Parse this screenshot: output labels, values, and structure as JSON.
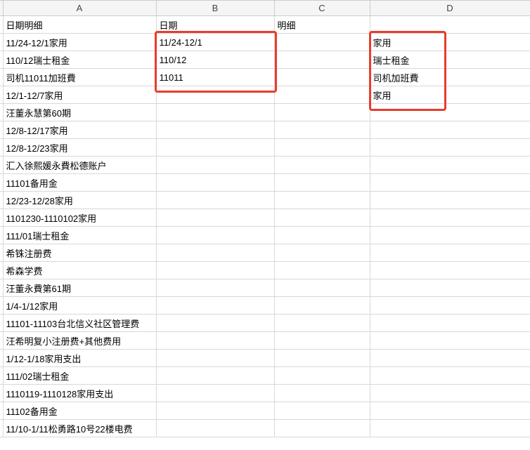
{
  "columns": {
    "A": "A",
    "B": "B",
    "C": "C",
    "D": "D"
  },
  "header_row": {
    "A": "日期明细",
    "B": "日期",
    "C": "明细",
    "D": ""
  },
  "rows": [
    {
      "A": "11/24-12/1家用",
      "B": "11/24-12/1",
      "C": "",
      "D": "家用"
    },
    {
      "A": "110/12瑞士租金",
      "B": "110/12",
      "C": "",
      "D": "瑞士租金"
    },
    {
      "A": "司机11011加班費",
      "B": "11011",
      "C": "",
      "D": "司机加班費"
    },
    {
      "A": "12/1-12/7家用",
      "B": "",
      "C": "",
      "D": "家用"
    },
    {
      "A": "汪董永慧第60期",
      "B": "",
      "C": "",
      "D": ""
    },
    {
      "A": "12/8-12/17家用",
      "B": "",
      "C": "",
      "D": ""
    },
    {
      "A": "12/8-12/23家用",
      "B": "",
      "C": "",
      "D": ""
    },
    {
      "A": "汇入徐熙媛永費松德账户",
      "B": "",
      "C": "",
      "D": ""
    },
    {
      "A": "11101备用金",
      "B": "",
      "C": "",
      "D": ""
    },
    {
      "A": "12/23-12/28家用",
      "B": "",
      "C": "",
      "D": ""
    },
    {
      "A": "1101230-1110102家用",
      "B": "",
      "C": "",
      "D": ""
    },
    {
      "A": "111/01瑞士租金",
      "B": "",
      "C": "",
      "D": ""
    },
    {
      "A": "希铢注册费",
      "B": "",
      "C": "",
      "D": ""
    },
    {
      "A": "希森学费",
      "B": "",
      "C": "",
      "D": ""
    },
    {
      "A": "汪董永費第61期",
      "B": "",
      "C": "",
      "D": ""
    },
    {
      "A": "1/4-1/12家用",
      "B": "",
      "C": "",
      "D": ""
    },
    {
      "A": "11101-11103台北信义社区管理费",
      "B": "",
      "C": "",
      "D": ""
    },
    {
      "A": "汪希明复小注册费+其他费用",
      "B": "",
      "C": "",
      "D": ""
    },
    {
      "A": "1/12-1/18家用支出",
      "B": "",
      "C": "",
      "D": ""
    },
    {
      "A": "111/02瑞士租金",
      "B": "",
      "C": "",
      "D": ""
    },
    {
      "A": "1110119-1110128家用支出",
      "B": "",
      "C": "",
      "D": ""
    },
    {
      "A": "11102备用金",
      "B": "",
      "C": "",
      "D": ""
    },
    {
      "A": "11/10-1/11松勇路10号22楼电费",
      "B": "",
      "C": "",
      "D": ""
    }
  ]
}
